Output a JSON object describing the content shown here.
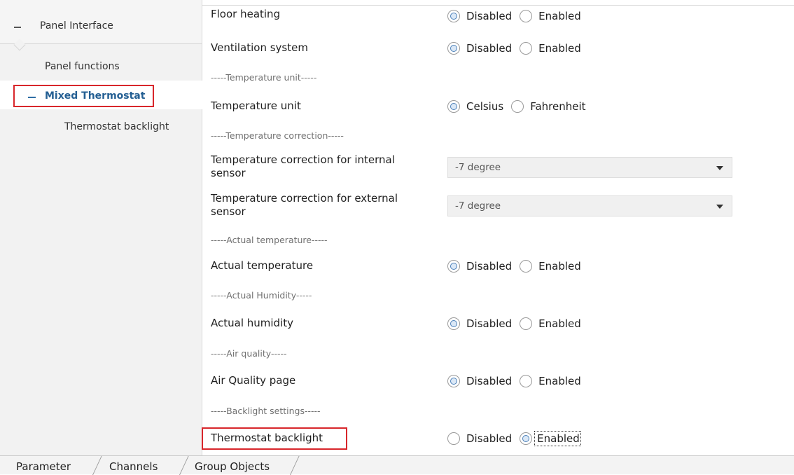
{
  "sidebar": {
    "header": "Panel Interface",
    "items": [
      "Panel functions",
      "Mixed Thermostat",
      "Thermostat backlight"
    ]
  },
  "rows": {
    "floor_heating": {
      "label": "Floor heating",
      "options": [
        "Disabled",
        "Enabled"
      ]
    },
    "ventilation": {
      "label": "Ventilation system",
      "options": [
        "Disabled",
        "Enabled"
      ]
    },
    "temp_unit": {
      "label": "Temperature unit",
      "options": [
        "Celsius",
        "Fahrenheit"
      ]
    },
    "temp_corr_internal": {
      "label": "Temperature correction for internal sensor",
      "value": "-7 degree"
    },
    "temp_corr_external": {
      "label": "Temperature correction for external sensor",
      "value": "-7 degree"
    },
    "actual_temp": {
      "label": "Actual temperature",
      "options": [
        "Disabled",
        "Enabled"
      ]
    },
    "actual_humidity": {
      "label": "Actual humidity",
      "options": [
        "Disabled",
        "Enabled"
      ]
    },
    "air_quality": {
      "label": "Air Quality page",
      "options": [
        "Disabled",
        "Enabled"
      ]
    },
    "thermostat_backlight": {
      "label": "Thermostat backlight",
      "options": [
        "Disabled",
        "Enabled"
      ]
    }
  },
  "sections": {
    "temp_unit": "-----Temperature unit-----",
    "temp_correction": "-----Temperature correction-----",
    "actual_temp": "-----Actual temperature-----",
    "actual_humidity": "-----Actual Humidity-----",
    "air_quality": "-----Air quality-----",
    "backlight": "-----Backlight settings-----"
  },
  "tabs": [
    "Parameter",
    "Channels",
    "Group Objects"
  ],
  "colors": {
    "highlight": "#d8262b",
    "selected_text": "#245f93"
  }
}
